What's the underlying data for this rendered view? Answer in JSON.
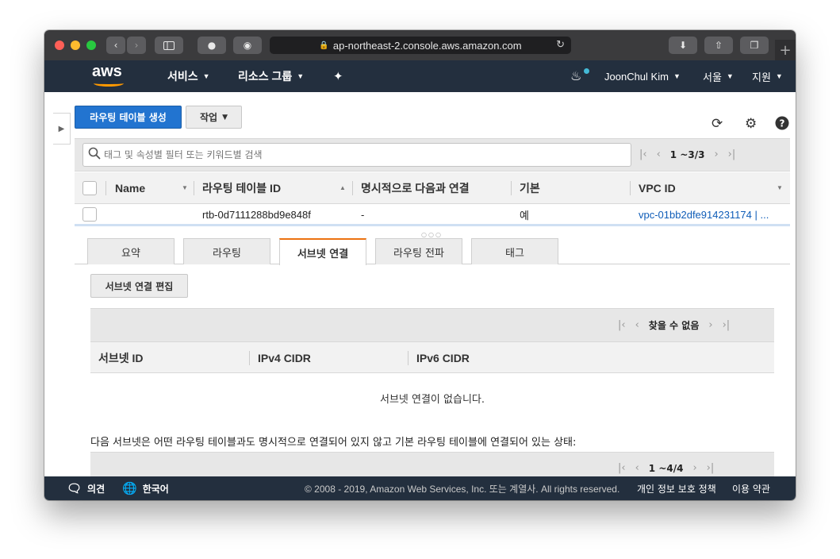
{
  "browser": {
    "url": "ap-northeast-2.console.aws.amazon.com",
    "new_tab": "+"
  },
  "nav": {
    "logo": "aws",
    "services": "서비스",
    "resource_groups": "리소스 그룹",
    "user": "JoonChul Kim",
    "region": "서울",
    "support": "지원"
  },
  "toolbar": {
    "create_button": "라우팅 테이블 생성",
    "actions_button": "작업"
  },
  "filter": {
    "placeholder": "태그 및 속성별 필터 또는 키워드별 검색",
    "range": "1 ~3/3"
  },
  "table": {
    "columns": [
      "Name",
      "라우팅 테이블 ID",
      "명시적으로 다음과 연결",
      "기본",
      "VPC ID"
    ],
    "rows": [
      {
        "name": "",
        "route_table_id": "rtb-0d7111288bd9e848f",
        "explicit": "-",
        "main": "예",
        "vpc_id": "vpc-01bb2dfe914231174 | ..."
      }
    ]
  },
  "tabs": [
    "요약",
    "라우팅",
    "서브넷 연결",
    "라우팅 전파",
    "태그"
  ],
  "active_tab": "서브넷 연결",
  "subnet_panel": {
    "edit_button": "서브넷 연결 편집",
    "pager_status": "찾을 수 없음",
    "columns": [
      "서브넷 ID",
      "IPv4 CIDR",
      "IPv6 CIDR"
    ],
    "empty_message": "서브넷 연결이 없습니다.",
    "description": "다음 서브넷은 어떤 라우팅 테이블과도 명시적으로 연결되어 있지 않고 기본 라우팅 테이블에 연결되어 있는 상태:",
    "second_range": "1 ~4/4"
  },
  "footer": {
    "feedback": "의견",
    "language": "한국어",
    "copyright": "© 2008 - 2019, Amazon Web Services, Inc. 또는 계열사. All rights reserved.",
    "privacy": "개인 정보 보호 정책",
    "terms": "이용 약관"
  },
  "colors": {
    "nav_bg": "#232f3e",
    "primary_button": "#2274d0",
    "active_tab_accent": "#ec7211",
    "link": "#0f5db8"
  }
}
